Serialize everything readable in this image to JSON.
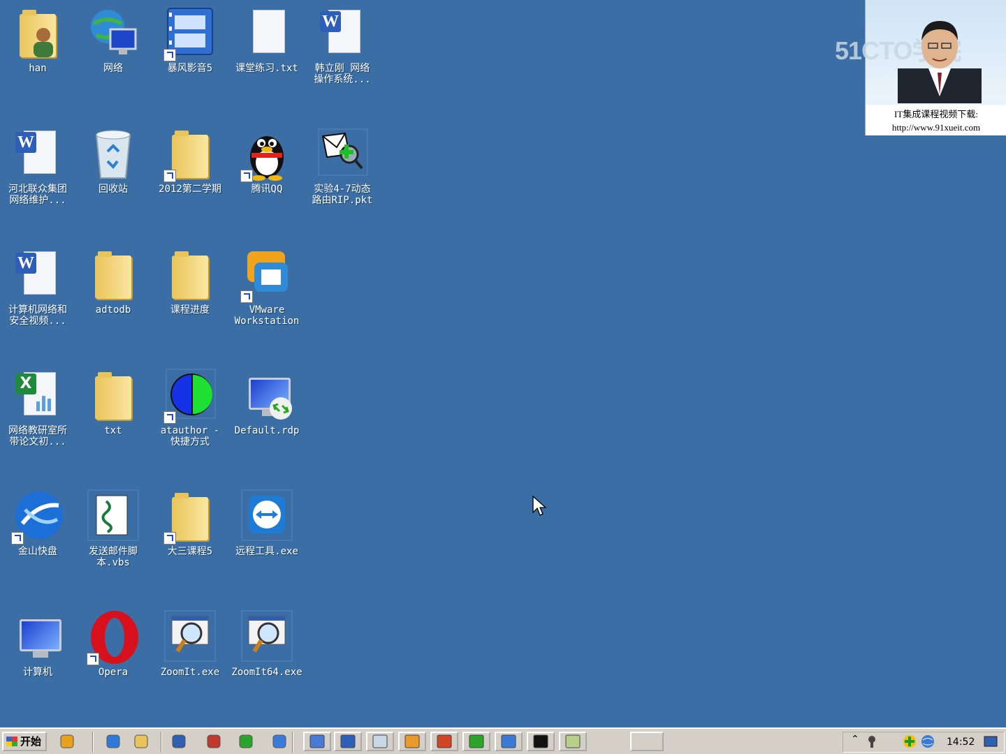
{
  "desktop": {
    "background": "#3a6ea5",
    "icons": [
      {
        "label": "han",
        "kind": "user-folder-icon",
        "shortcut": false
      },
      {
        "label": "网络",
        "kind": "network-globe-icon",
        "shortcut": false
      },
      {
        "label": "暴风影音5",
        "kind": "video-player-icon",
        "shortcut": true
      },
      {
        "label": "课堂练习.txt",
        "kind": "text-file-icon",
        "shortcut": false
      },
      {
        "label": "韩立刚_网络\n操作系统...",
        "kind": "word-doc-icon",
        "shortcut": false
      },
      {
        "label": "河北联众集团\n网络维护...",
        "kind": "word-doc-icon",
        "shortcut": false
      },
      {
        "label": "回收站",
        "kind": "recycle-bin-icon",
        "shortcut": false
      },
      {
        "label": "2012第二学期",
        "kind": "folder-icon",
        "shortcut": true
      },
      {
        "label": "腾讯QQ",
        "kind": "qq-penguin-icon",
        "shortcut": true
      },
      {
        "label": "实验4-7动态\n路由RIP.pkt",
        "kind": "packet-tracer-file-icon",
        "shortcut": false
      },
      {
        "label": "计算机网络和\n安全视频...",
        "kind": "word-doc-icon",
        "shortcut": false
      },
      {
        "label": "adtodb",
        "kind": "folder-icon",
        "shortcut": false
      },
      {
        "label": "课程进度",
        "kind": "folder-icon",
        "shortcut": false
      },
      {
        "label": "VMware\nWorkstation",
        "kind": "vmware-icon",
        "shortcut": true
      },
      {
        "label": "网络教研室所\n带论文初...",
        "kind": "excel-doc-icon",
        "shortcut": false
      },
      {
        "label": "txt",
        "kind": "folder-icon",
        "shortcut": false
      },
      {
        "label": "atauthor -\n快捷方式",
        "kind": "atauthor-icon",
        "shortcut": true
      },
      {
        "label": "Default.rdp",
        "kind": "remote-desktop-icon",
        "shortcut": false
      },
      {
        "label": "金山快盘",
        "kind": "kuaipan-icon",
        "shortcut": true
      },
      {
        "label": "发送邮件脚\n本.vbs",
        "kind": "vbs-script-icon",
        "shortcut": false
      },
      {
        "label": "大三课程5",
        "kind": "folder-icon",
        "shortcut": true
      },
      {
        "label": "远程工具.exe",
        "kind": "teamviewer-icon",
        "shortcut": false
      },
      {
        "label": "计算机",
        "kind": "computer-icon",
        "shortcut": false
      },
      {
        "label": "Opera",
        "kind": "opera-icon",
        "shortcut": true
      },
      {
        "label": "ZoomIt.exe",
        "kind": "zoomit-icon",
        "shortcut": false
      },
      {
        "label": "ZoomIt64.exe",
        "kind": "zoomit-icon",
        "shortcut": false
      }
    ]
  },
  "overlay": {
    "brand": "51CTO学院",
    "caption_line1": "IT集成课程视频下载:",
    "caption_line2": "http://www.91xueit.com"
  },
  "taskbar": {
    "start_label": "开始",
    "quick_launch": [
      "show-desktop-icon",
      "ie-icon",
      "explorer-icon",
      "media-icon",
      "winrar-icon",
      "ie2-icon",
      "globe-icon"
    ],
    "tasks": [
      "network-task-icon",
      "word-task-icon",
      "notepad-task-icon",
      "paint-task-icon",
      "powerpoint-task-icon",
      "flag-task-icon",
      "rdp-task-icon",
      "cmd-task-icon",
      "edit-task-icon",
      "blank-task"
    ],
    "clock": "14:52"
  }
}
